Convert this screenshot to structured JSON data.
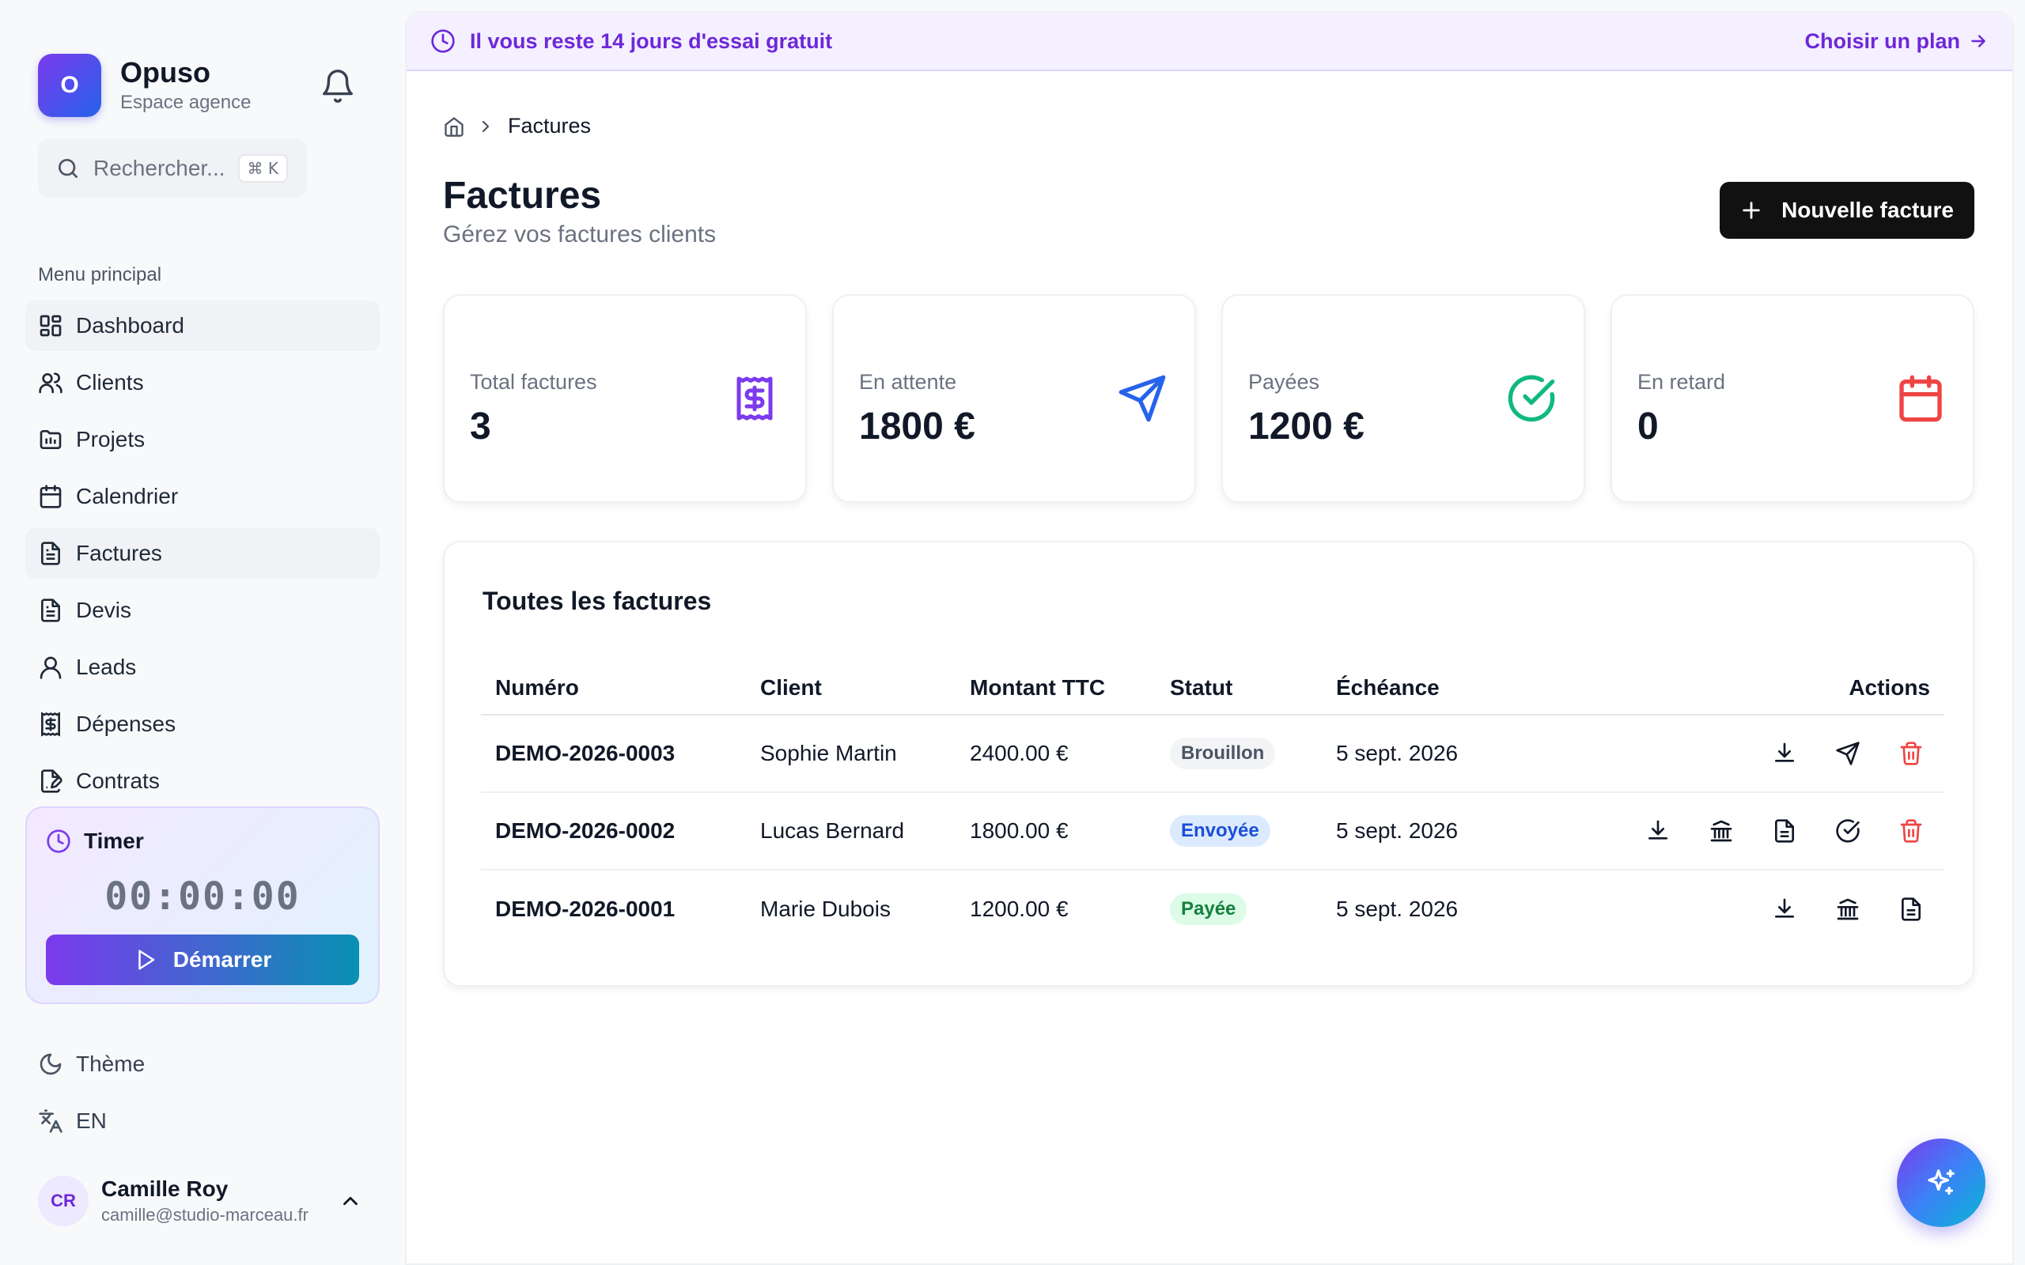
{
  "brand": {
    "logo_letter": "O",
    "name": "Opuso",
    "subtitle": "Espace agence"
  },
  "search": {
    "placeholder": "Rechercher...",
    "shortcut": "⌘ K"
  },
  "sidebar": {
    "menu_title": "Menu principal",
    "items": [
      {
        "label": "Dashboard",
        "icon": "layout-grid-icon"
      },
      {
        "label": "Clients",
        "icon": "users-icon"
      },
      {
        "label": "Projets",
        "icon": "folder-icon"
      },
      {
        "label": "Calendrier",
        "icon": "calendar-icon"
      },
      {
        "label": "Factures",
        "icon": "file-text-icon",
        "active": true
      },
      {
        "label": "Devis",
        "icon": "file-text-icon"
      },
      {
        "label": "Leads",
        "icon": "user-icon"
      },
      {
        "label": "Dépenses",
        "icon": "receipt-icon"
      },
      {
        "label": "Contrats",
        "icon": "file-signature-icon"
      }
    ]
  },
  "timer": {
    "title": "Timer",
    "value": "00:00:00",
    "start_label": "Démarrer"
  },
  "settings": {
    "theme_label": "Thème",
    "language_label": "EN"
  },
  "user": {
    "initials": "CR",
    "name": "Camille Roy",
    "email": "camille@studio-marceau.fr"
  },
  "banner": {
    "text": "Il vous reste 14 jours d'essai gratuit",
    "cta": "Choisir un plan"
  },
  "breadcrumb": {
    "current": "Factures"
  },
  "page": {
    "title": "Factures",
    "subtitle": "Gérez vos factures clients",
    "new_button": "Nouvelle facture"
  },
  "stats": [
    {
      "label": "Total factures",
      "value": "3",
      "icon": "receipt-dollar-icon",
      "color": "#7c3aed"
    },
    {
      "label": "En attente",
      "value": "1800 €",
      "icon": "send-icon",
      "color": "#2563eb"
    },
    {
      "label": "Payées",
      "value": "1200 €",
      "icon": "check-circle-icon",
      "color": "#10b981"
    },
    {
      "label": "En retard",
      "value": "0",
      "icon": "calendar-icon",
      "color": "#ef4444"
    }
  ],
  "table": {
    "title": "Toutes les factures",
    "headers": {
      "number": "Numéro",
      "client": "Client",
      "amount": "Montant TTC",
      "status": "Statut",
      "due": "Échéance",
      "actions": "Actions"
    },
    "rows": [
      {
        "number": "DEMO-2026-0003",
        "client": "Sophie Martin",
        "amount": "2400.00 €",
        "status": "Brouillon",
        "due": "5 sept. 2026",
        "actions": [
          "download-icon",
          "send-icon",
          "trash-icon"
        ]
      },
      {
        "number": "DEMO-2026-0002",
        "client": "Lucas Bernard",
        "amount": "1800.00 €",
        "status": "Envoyée",
        "due": "5 sept. 2026",
        "actions": [
          "download-icon",
          "bank-icon",
          "file-icon",
          "check-circle-icon",
          "trash-icon"
        ]
      },
      {
        "number": "DEMO-2026-0001",
        "client": "Marie Dubois",
        "amount": "1200.00 €",
        "status": "Payée",
        "due": "5 sept. 2026",
        "actions": [
          "download-icon",
          "bank-icon",
          "file-icon"
        ]
      }
    ]
  },
  "colors": {
    "accent": "#6d28d9",
    "primary_button": "#111111",
    "danger": "#ef4444"
  }
}
